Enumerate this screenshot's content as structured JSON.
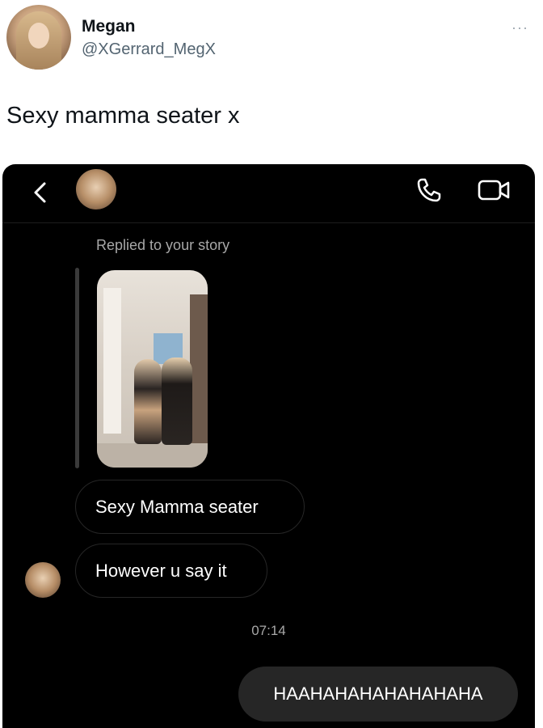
{
  "tweet": {
    "name": "Megan",
    "handle": "@XGerrard_MegX",
    "more": "···",
    "text": "Sexy mamma seater x"
  },
  "dm": {
    "story_label": "Replied to your story",
    "messages": [
      {
        "text": "Sexy Mamma seater",
        "from": "other"
      },
      {
        "text": "However u say it",
        "from": "other"
      }
    ],
    "timestamp": "07:14",
    "my_message": "HAAHAHAHAHAHAHAHA"
  },
  "icons": {
    "back": "chevron-left-icon",
    "phone": "phone-icon",
    "video": "video-camera-icon"
  },
  "colors": {
    "background": "#000000",
    "bubble_border": "#262626",
    "my_bubble": "#262626",
    "secondary_text": "#a8a8a8"
  }
}
